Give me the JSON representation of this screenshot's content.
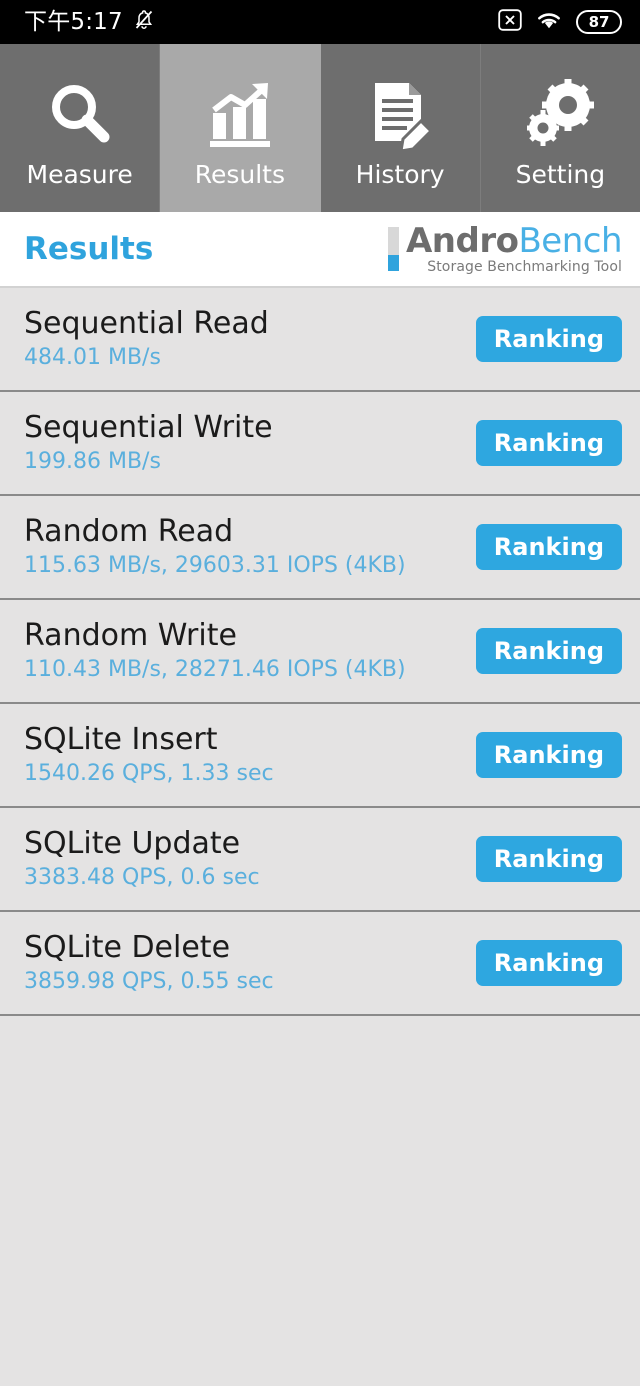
{
  "statusbar": {
    "time": "下午5:17",
    "bell_icon": "bell-muted-icon",
    "x_icon": "x-box-icon",
    "wifi_icon": "wifi-icon",
    "battery_level": "87"
  },
  "tabs": [
    {
      "label": "Measure",
      "icon": "magnifier-icon",
      "selected": false
    },
    {
      "label": "Results",
      "icon": "bar-chart-arrow-icon",
      "selected": true
    },
    {
      "label": "History",
      "icon": "document-pencil-icon",
      "selected": false
    },
    {
      "label": "Setting",
      "icon": "gears-icon",
      "selected": false
    }
  ],
  "header": {
    "title": "Results",
    "logo_primary": "Andro",
    "logo_secondary": "Bench",
    "logo_subtitle": "Storage Benchmarking Tool"
  },
  "results": {
    "button_label": "Ranking",
    "rows": [
      {
        "title": "Sequential Read",
        "value": "484.01 MB/s"
      },
      {
        "title": "Sequential Write",
        "value": "199.86 MB/s"
      },
      {
        "title": "Random Read",
        "value": "115.63 MB/s, 29603.31 IOPS (4KB)"
      },
      {
        "title": "Random Write",
        "value": "110.43 MB/s, 28271.46 IOPS (4KB)"
      },
      {
        "title": "SQLite Insert",
        "value": "1540.26 QPS, 1.33 sec"
      },
      {
        "title": "SQLite Update",
        "value": "3383.48 QPS, 0.6 sec"
      },
      {
        "title": "SQLite Delete",
        "value": "3859.98 QPS, 0.55 sec"
      }
    ]
  },
  "colors": {
    "accent_blue": "#2ea7e0",
    "value_blue": "#5aafdd",
    "tab_bg": "#6e6e6e",
    "tab_selected_bg": "#a9a9a9",
    "list_bg": "#e4e3e3"
  }
}
